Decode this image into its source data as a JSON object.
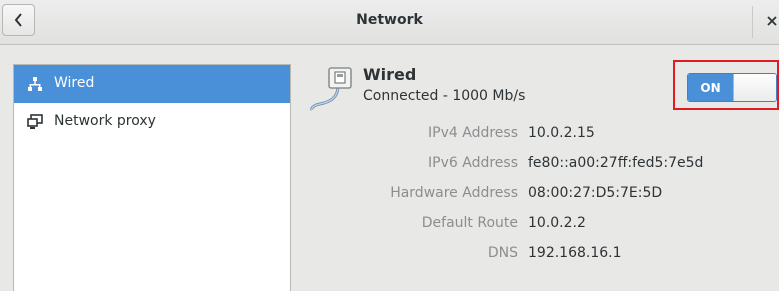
{
  "window": {
    "title": "Network"
  },
  "sidebar": {
    "items": [
      {
        "label": "Wired",
        "icon": "wired-network-icon",
        "selected": true
      },
      {
        "label": "Network proxy",
        "icon": "network-proxy-icon",
        "selected": false
      }
    ]
  },
  "device": {
    "name": "Wired",
    "status": "Connected - 1000 Mb/s",
    "icon": "ethernet-cable-icon",
    "switch_label": "ON",
    "switch_on": true
  },
  "properties": [
    {
      "label": "IPv4 Address",
      "value": "10.0.2.15"
    },
    {
      "label": "IPv6 Address",
      "value": "fe80::a00:27ff:fed5:7e5d"
    },
    {
      "label": "Hardware Address",
      "value": "08:00:27:D5:7E:5D"
    },
    {
      "label": "Default Route",
      "value": "10.0.2.2"
    },
    {
      "label": "DNS",
      "value": "192.168.16.1"
    }
  ],
  "colors": {
    "accent": "#4a90d9",
    "highlight": "#e01b24",
    "label_gray": "#8b8e8f"
  }
}
